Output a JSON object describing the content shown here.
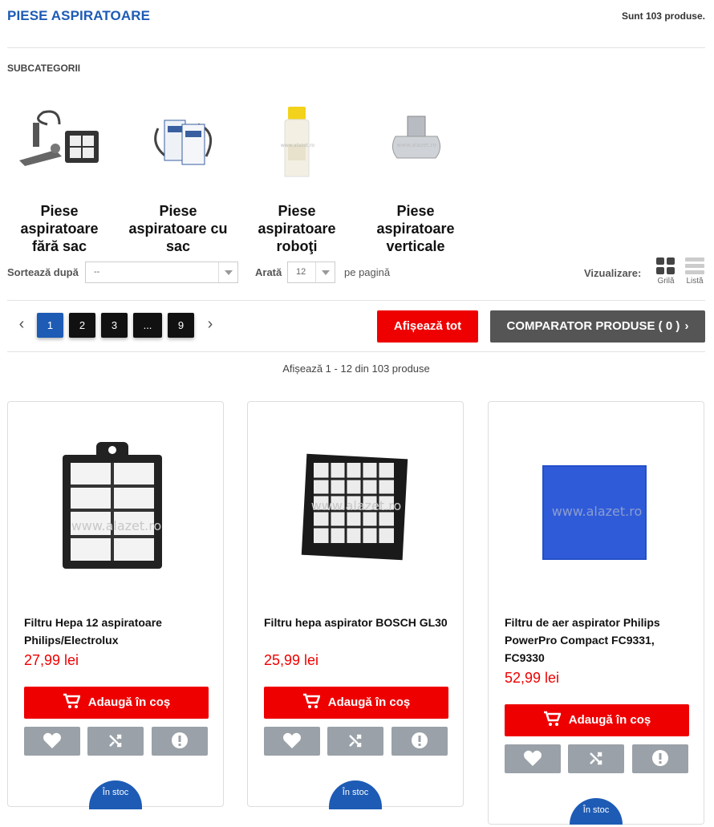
{
  "header": {
    "title": "PIESE ASPIRATOARE",
    "count_text": "Sunt 103 produse."
  },
  "subcategories": {
    "title": "SUBCATEGORII",
    "items": [
      {
        "label": "Piese aspiratoare fără sac",
        "icon": "bagless-vacuum-parts"
      },
      {
        "label": "Piese aspiratoare cu sac",
        "icon": "bag-vacuum-parts"
      },
      {
        "label": "Piese aspiratoare roboţi",
        "icon": "robot-vacuum-parts"
      },
      {
        "label": "Piese aspiratoare verticale",
        "icon": "vertical-vacuum-parts"
      }
    ],
    "watermark": "www.alazet.ro"
  },
  "toolbar": {
    "sort_label": "Sortează după",
    "sort_value": "--",
    "show_label": "Arată",
    "show_value": "12",
    "per_page_label": "pe pagină",
    "view_label": "Vizualizare:",
    "view_grid_label": "Grilă",
    "view_list_label": "Listă"
  },
  "pagination": {
    "prev": "‹",
    "next": "›",
    "pages": [
      "1",
      "2",
      "3",
      "...",
      "9"
    ],
    "active_page": "1",
    "show_all_label": "Afișează tot",
    "compare_label": "COMPARATOR PRODUSE ( 0 )"
  },
  "results_text": "Afișează 1 - 12 din 103 produse",
  "products": [
    {
      "name": "Filtru Hepa 12 aspiratoare Philips/Electrolux",
      "price": "27,99 lei",
      "cart_label": "Adaugă în coș",
      "stock": "În stoc"
    },
    {
      "name": "Filtru hepa aspirator BOSCH GL30",
      "price": "25,99 lei",
      "cart_label": "Adaugă în coș",
      "stock": "În stoc"
    },
    {
      "name": "Filtru de aer aspirator Philips PowerPro Compact FC9331, FC9330",
      "price": "52,99 lei",
      "cart_label": "Adaugă în coș",
      "stock": "În stoc"
    }
  ],
  "colors": {
    "brand_blue": "#1d5bb5",
    "accent_red": "#ee0000",
    "action_gray": "#9aa1a8",
    "compare_gray": "#555555"
  }
}
